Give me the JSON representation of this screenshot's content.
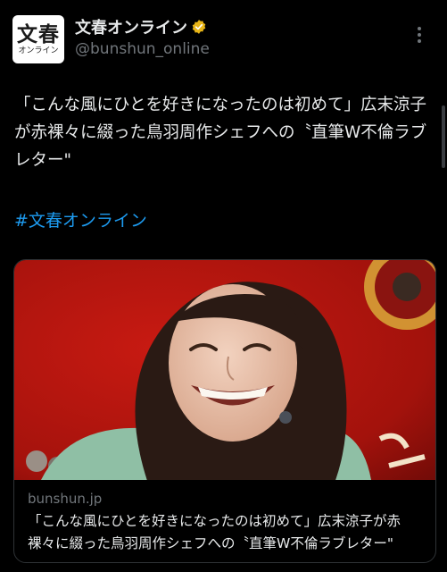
{
  "account": {
    "display_name": "文春オンライン",
    "handle": "@bunshun_online",
    "avatar_big": "文春",
    "avatar_small": "オンライン",
    "verified_color": "#e8b517"
  },
  "post": {
    "text": "「こんな風にひとを好きになったのは初めて」広末涼子が赤裸々に綴った鳥羽周作シェフへの〝直筆W不倫ラブレター\"",
    "hashtag": "#文春オンライン"
  },
  "card": {
    "domain": "bunshun.jp",
    "title": "「こんな風にひとを好きになったのは初めて」広末涼子が赤裸々に綴った鳥羽周作シェフへの〝直筆W不倫ラブレター\""
  },
  "colors": {
    "background": "#000000",
    "text": "#e7e9ea",
    "secondary": "#71767b",
    "link": "#1d9bf0"
  }
}
